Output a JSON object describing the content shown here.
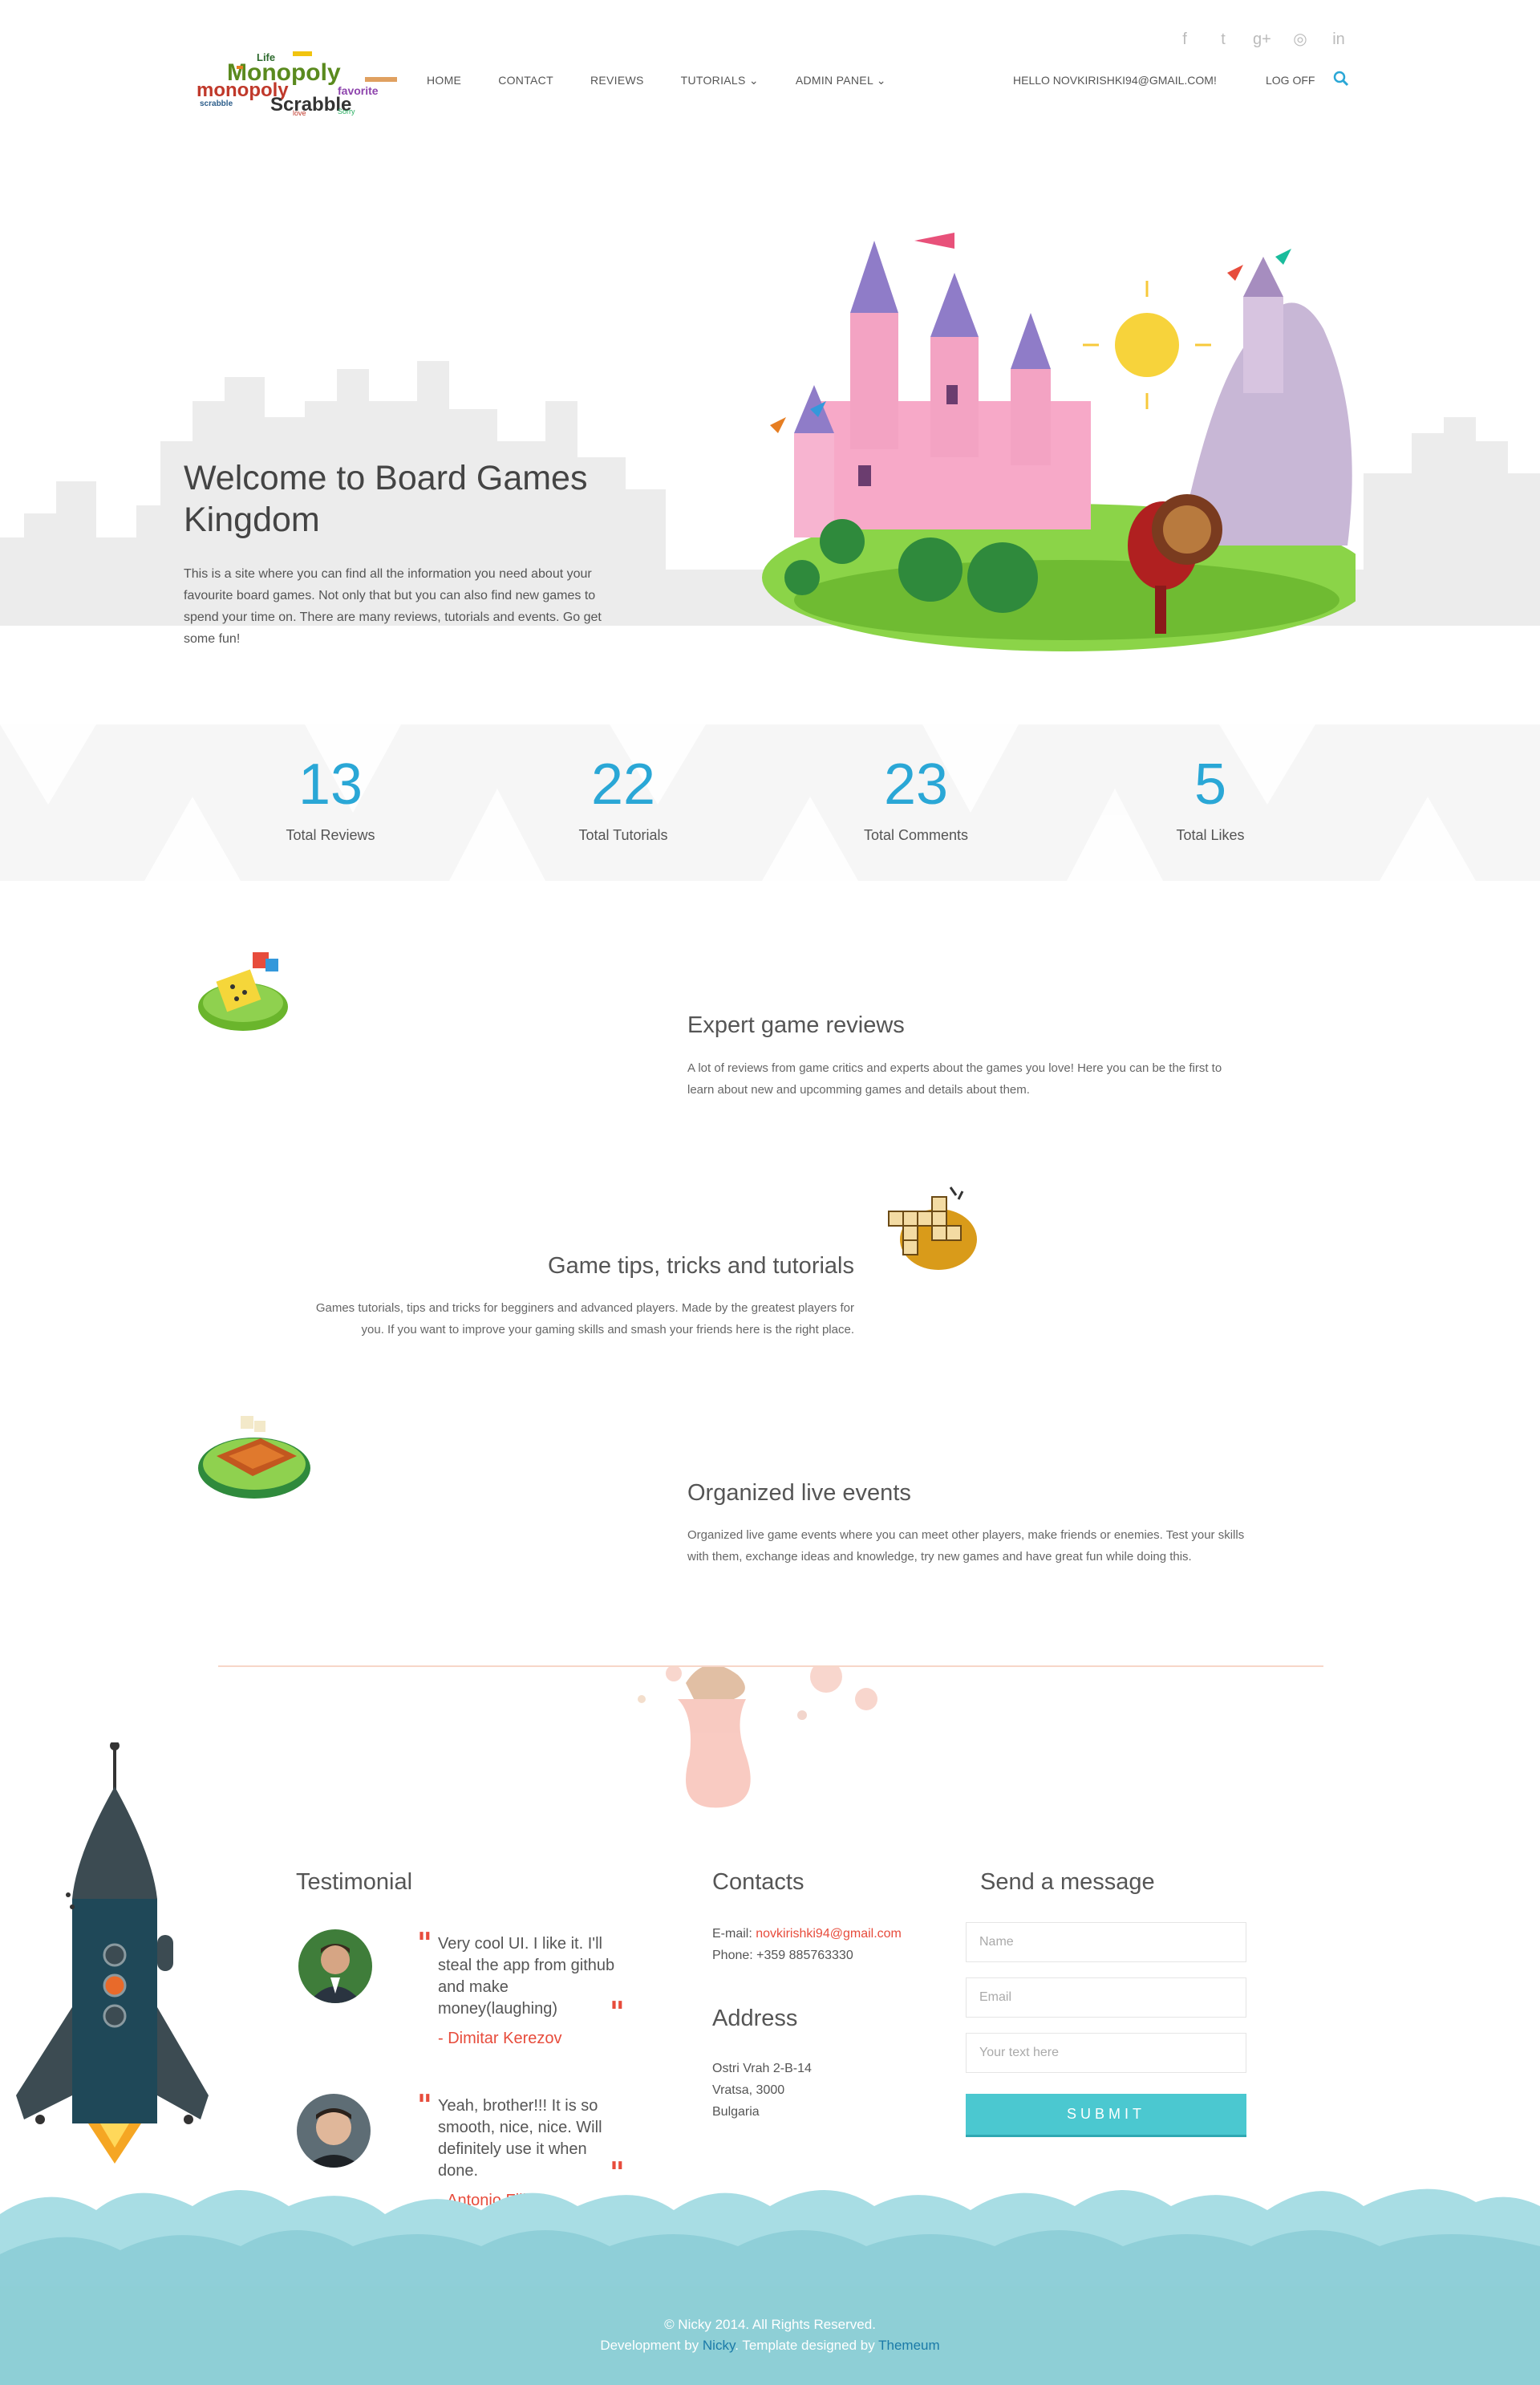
{
  "header": {
    "logo_words": [
      "Life",
      "Monopoly",
      "monopoly",
      "Scrabble",
      "favorite",
      "scrabble",
      "love",
      "Sorry"
    ],
    "nav": [
      "HOME",
      "CONTACT",
      "REVIEWS",
      "TUTORIALS",
      "ADMIN PANEL"
    ],
    "nav_dropdowns": [
      "TUTORIALS",
      "ADMIN PANEL"
    ],
    "user_greeting": "HELLO NOVKIRISHKI94@GMAIL.COM!",
    "logoff": "LOG OFF",
    "social_icons": [
      "facebook-icon",
      "twitter-icon",
      "google-plus-icon",
      "dribbble-icon",
      "linkedin-icon"
    ],
    "social_glyphs": [
      "f",
      "t",
      "g+",
      "◎",
      "in"
    ]
  },
  "hero": {
    "title": "Welcome to Board Games Kingdom",
    "text": "This is a site where you can find all the information you need about your favourite board games. Not only that but you can also find new games to spend your time on. There are many reviews, tutorials and events. Go get some fun!"
  },
  "stats": [
    {
      "value": "13",
      "label": "Total Reviews"
    },
    {
      "value": "22",
      "label": "Total Tutorials"
    },
    {
      "value": "23",
      "label": "Total Comments"
    },
    {
      "value": "5",
      "label": "Total Likes"
    }
  ],
  "features": [
    {
      "title": "Expert game reviews",
      "text": "A lot of reviews from game critics and experts about the games you love! Here you can be the first to learn about new and upcomming games and details about them."
    },
    {
      "title": "Game tips, tricks and tutorials",
      "text": "Games tutorials, tips and tricks for begginers and advanced players. Made by the greatest players for you. If you want to improve your gaming skills and smash your friends here is the right place."
    },
    {
      "title": "Organized live events",
      "text": "Organized live game events where you can meet other players, make friends or enemies. Test your skills with them, exchange ideas and knowledge, try new games and have great fun while doing this."
    }
  ],
  "testimonial": {
    "title": "Testimonial",
    "items": [
      {
        "quote": "Very cool UI. I like it. I'll steal the app from github and make money(laughing)",
        "author": "- Dimitar Kerezov"
      },
      {
        "quote": "Yeah, brother!!! It is so smooth, nice, nice. Will definitely use it when done.",
        "author": "- Antonio Filipov"
      }
    ]
  },
  "contacts": {
    "title": "Contacts",
    "email_label": "E-mail:",
    "email": "novkirishki94@gmail.com",
    "phone": "Phone: +359 885763330"
  },
  "address": {
    "title": "Address",
    "lines": [
      "Ostri Vrah 2-B-14",
      "Vratsa, 3000",
      "Bulgaria"
    ]
  },
  "message": {
    "title": "Send a message",
    "name_placeholder": "Name",
    "email_placeholder": "Email",
    "text_placeholder": "Your text here",
    "submit": "SUBMIT"
  },
  "footer": {
    "copyright": "© Nicky 2014. All Rights Reserved.",
    "dev_prefix": "Development by",
    "dev_name": "Nicky",
    "template_prefix": ". Template designed by",
    "template_name": "Themeum"
  },
  "colors": {
    "accent_blue": "#2aa7d6",
    "accent_red": "#e74c3c",
    "submit": "#4bc8d0",
    "footer": "#8ecfd6"
  }
}
